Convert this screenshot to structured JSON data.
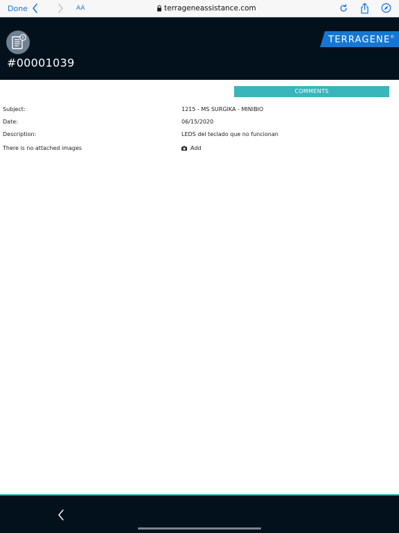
{
  "browser": {
    "done_label": "Done",
    "aa_label": "AA",
    "url": "terrageneassistance.com",
    "accent_color": "#1a73e8"
  },
  "header": {
    "ticket_id": "#00001039",
    "brand": "TERRAGENE",
    "brand_mark": "®",
    "background_color": "#03111d",
    "brand_color": "#1577d3"
  },
  "main": {
    "comments_label": "COMMENTS",
    "comments_color": "#38b6bb",
    "fields": [
      {
        "label": "Subject:",
        "value": "1215 - MS SURGIKA - MINIBIO"
      },
      {
        "label": "Date:",
        "value": "06/15/2020"
      },
      {
        "label": "Description:",
        "value": "LEDS del teclado que no funcionan"
      }
    ],
    "images_label": "There is no attached images",
    "add_label": "Add"
  },
  "icons": {
    "back": "chevron-left-icon",
    "forward": "chevron-right-icon",
    "lock": "lock-icon",
    "reload": "reload-icon",
    "share": "share-icon",
    "compass": "compass-icon",
    "ticket": "document-info-icon",
    "camera": "camera-icon",
    "bottom_back": "chevron-left-icon"
  }
}
